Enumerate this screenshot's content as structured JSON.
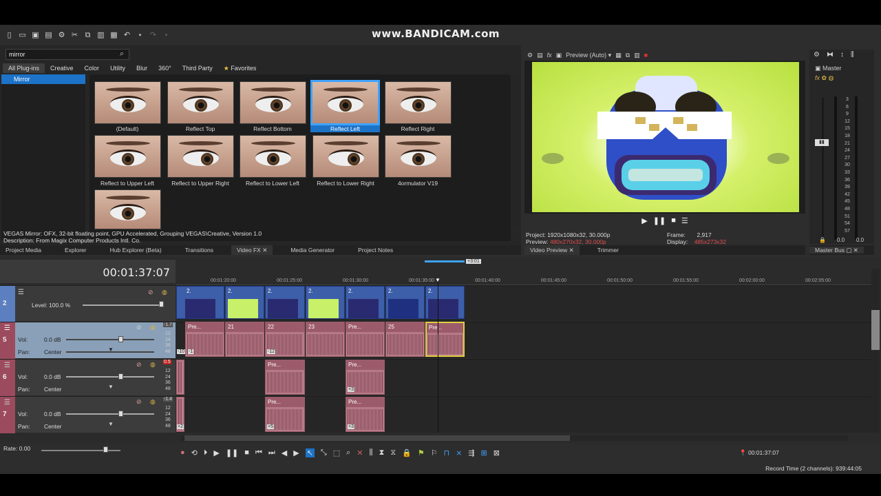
{
  "watermark": "www.BANDICAM.com",
  "plugins": {
    "search_value": "mirror",
    "categories": [
      "All Plug-ins",
      "Creative",
      "Color",
      "Utility",
      "Blur",
      "360°",
      "Third Party",
      "Favorites"
    ],
    "tree_item": "Mirror",
    "presets": [
      "(Default)",
      "Reflect Top",
      "Reflect Bottom",
      "Reflect Left",
      "Reflect Right",
      "Reflect to Upper Left",
      "Reflect to Upper Right",
      "Reflect to Lower Left",
      "Reflect to Lower Right",
      "4ormulator V19"
    ],
    "selected_preset": "Reflect Left",
    "description_line1": "VEGAS Mirror: OFX, 32-bit floating point, GPU Accelerated, Grouping VEGAS\\Creative, Version 1.0",
    "description_line2": "Description: From Magix Computer Products Intl. Co."
  },
  "dock_tabs_left": [
    "Project Media",
    "Explorer",
    "Hub Explorer (Beta)",
    "Transitions",
    "Video FX",
    "Media Generator",
    "Project Notes"
  ],
  "preview": {
    "mode": "Preview (Auto)",
    "project_label": "Project:",
    "project_value": "1920x1080x32, 30.000p",
    "preview_label": "Preview:",
    "preview_value": "480x270x32, 30.000p",
    "frame_label": "Frame:",
    "frame_value": "2,917",
    "display_label": "Display:",
    "display_value": "485x273x32",
    "tabs": [
      "Video Preview",
      "Trimmer"
    ]
  },
  "master": {
    "title": "Master",
    "scale": [
      "3",
      "6",
      "9",
      "12",
      "15",
      "18",
      "21",
      "24",
      "27",
      "30",
      "33",
      "36",
      "39",
      "42",
      "45",
      "48",
      "51",
      "54",
      "57"
    ],
    "bottom_left": "0.0",
    "bottom_right": "0.0",
    "tab": "Master Bus"
  },
  "timeline": {
    "timecode": "00:01:37:07",
    "ruler": [
      "00:01:20:00",
      "00:01:25:00",
      "00:01:30:00",
      "00:01:35:00",
      "00:01:40:00",
      "00:01:45:00",
      "00:01:50:00",
      "00:01:55:00",
      "00:02:00:00",
      "00:02:05:00"
    ],
    "marker": "+3:01",
    "video_track": {
      "number": "2",
      "level": "Level: 100.0 %"
    },
    "audio_tracks": [
      {
        "number": "5",
        "vol_label": "Vol:",
        "vol": "0.0 dB",
        "pan_label": "Pan:",
        "pan": "Center",
        "peak": "-1.7"
      },
      {
        "number": "6",
        "vol_label": "Vol:",
        "vol": "0.0 dB",
        "pan_label": "Pan:",
        "pan": "Center",
        "peak": "0.5"
      },
      {
        "number": "7",
        "vol_label": "Vol:",
        "vol": "0.0 dB",
        "pan_label": "Pan:",
        "pan": "Center",
        "peak": "-1.4"
      }
    ],
    "meter_scale": [
      "12",
      "24",
      "36",
      "48"
    ],
    "clip_labels": [
      "Pre...",
      "21",
      "22",
      "23",
      "Pre...",
      "25",
      "Pre..."
    ],
    "clip_badges": [
      "-10",
      "-1",
      "-12",
      "+3",
      "+5",
      "+3",
      "+2"
    ],
    "video_clip_label": "2."
  },
  "transport": {
    "rate": "Rate: 0.00",
    "cursor_time": "00:01:37:07"
  },
  "status": {
    "record_time": "Record Time (2 channels): 939:44:05"
  }
}
